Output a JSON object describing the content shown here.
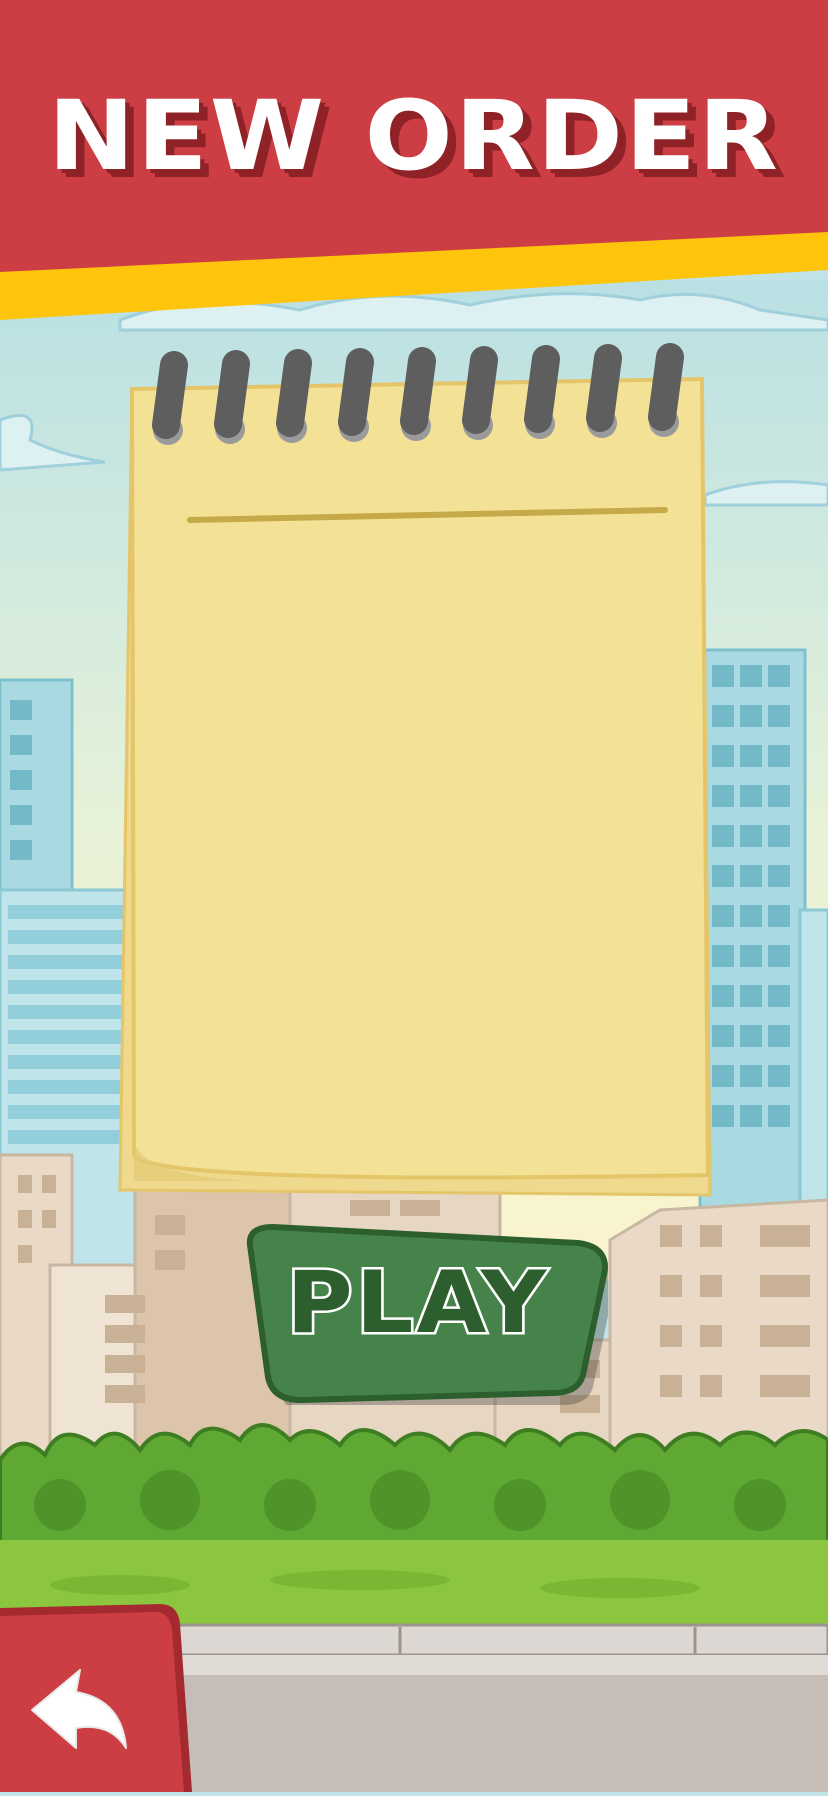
{
  "header": {
    "title": "NEW ORDER",
    "colors": {
      "banner": "#cc3e44",
      "stripe": "#ffc40c",
      "title_text": "#ffffff",
      "title_shadow": "#8f2226"
    }
  },
  "notepad": {
    "state": "empty",
    "spiral_rings": 9,
    "colors": {
      "paper": "#f3e196",
      "border": "#e4c56a",
      "line": "#c6a948",
      "rings": "#5e5e5e"
    }
  },
  "play_button": {
    "label": "PLAY",
    "colors": {
      "fill": "#45834a",
      "border": "#2c5f2d",
      "label": "#2c5f2d",
      "label_outline": "#ffffff"
    }
  },
  "back_button": {
    "icon": "back-arrow-icon",
    "colors": {
      "fill": "#cc3e44",
      "border": "#a52a30",
      "icon": "#ffffff"
    }
  },
  "background": {
    "theme": "city-street",
    "colors": {
      "sky_top": "#bfe3e6",
      "sky_bottom": "#fbf4cc",
      "grass": "#8cc63f",
      "bushes": "#5fa833",
      "sidewalk": "#c9c2bc"
    }
  }
}
